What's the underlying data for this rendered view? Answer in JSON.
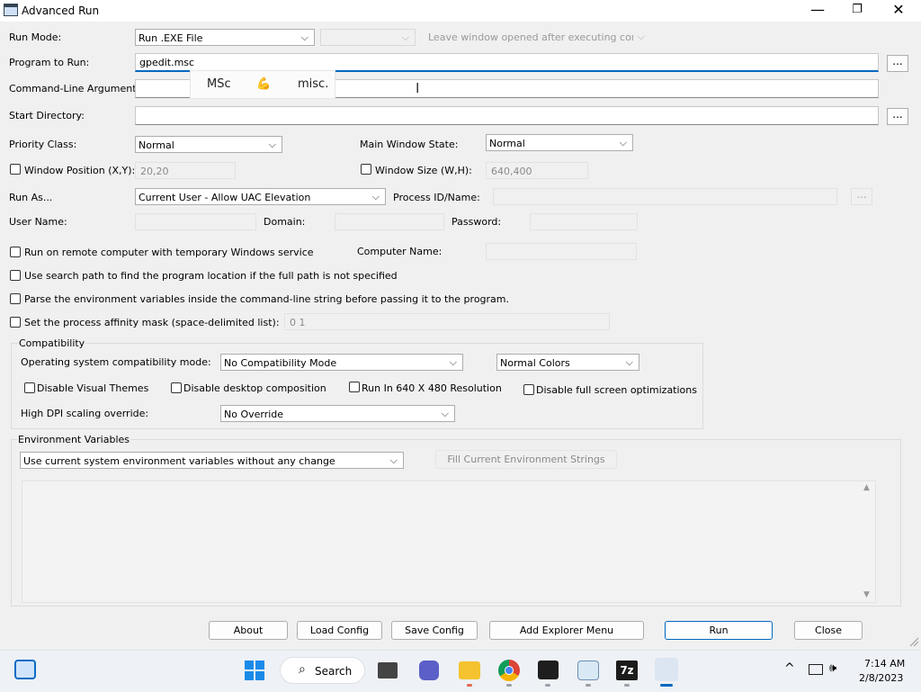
{
  "window": {
    "title": "Advanced Run"
  },
  "labels": {
    "run_mode": "Run Mode:",
    "program": "Program to Run:",
    "cmd_args": "Command-Line Arguments:",
    "start_dir": "Start Directory:",
    "priority": "Priority Class:",
    "main_window_state": "Main Window State:",
    "window_position": "Window Position (X,Y):",
    "window_size": "Window Size (W,H):",
    "run_as": "Run As...",
    "process_id": "Process ID/Name:",
    "user_name": "User Name:",
    "domain": "Domain:",
    "password": "Password:",
    "remote": "Run on remote computer with temporary Windows service",
    "computer_name": "Computer Name:",
    "search_path": "Use search path to find the program location if the full path is not specified",
    "parse_env": "Parse the environment variables inside the command-line string before passing it to the program.",
    "affinity": "Set the process affinity mask (space-delimited list):",
    "compat_group": "Compatibility",
    "os_compat": "Operating system compatibility mode:",
    "disable_themes": "Disable Visual Themes",
    "disable_desktop": "Disable desktop composition",
    "run_640": "Run In 640 X 480 Resolution",
    "disable_fullscreen": "Disable full screen optimizations",
    "high_dpi": "High DPI scaling override:",
    "env_group": "Environment Variables"
  },
  "values": {
    "run_mode": "Run .EXE File",
    "leave_window": "Leave window opened after executing command",
    "program": "gpedit.msc",
    "priority": "Normal",
    "main_window_state": "Normal",
    "window_position": "20,20",
    "window_size": "640,400",
    "run_as": "Current User - Allow UAC Elevation",
    "affinity": "0 1",
    "os_compat": "No Compatibility Mode",
    "colors": "Normal Colors",
    "high_dpi": "No Override",
    "env_mode": "Use current system environment variables without any change"
  },
  "autocomplete": [
    "MSc",
    "💪",
    "misc."
  ],
  "buttons": {
    "browse": "...",
    "fill_env": "Fill Current Environment Strings",
    "about": "About",
    "load_config": "Load Config",
    "save_config": "Save Config",
    "add_explorer": "Add Explorer Menu",
    "run": "Run",
    "close": "Close"
  },
  "taskbar": {
    "search": "Search",
    "time": "7:14 AM",
    "date": "2/8/2023",
    "seven_zip": "7z"
  },
  "colors": {
    "accent": "#0067c0"
  }
}
